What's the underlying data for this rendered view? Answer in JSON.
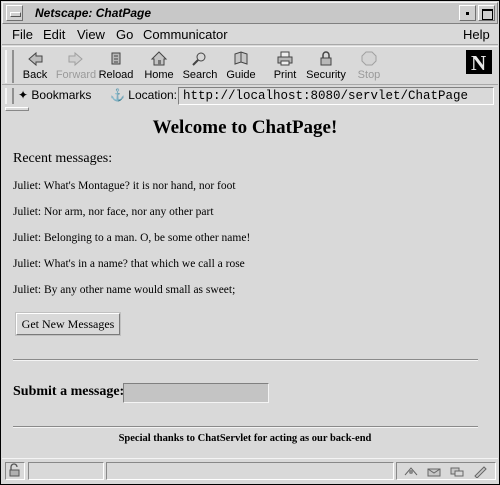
{
  "window": {
    "title": "Netscape: ChatPage"
  },
  "menubar": {
    "items": [
      "File",
      "Edit",
      "View",
      "Go",
      "Communicator"
    ],
    "help": "Help"
  },
  "toolbar": {
    "buttons": [
      {
        "label": "Back",
        "icon": "back-arrow-icon",
        "enabled": true
      },
      {
        "label": "Forward",
        "icon": "forward-arrow-icon",
        "enabled": false
      },
      {
        "label": "Reload",
        "icon": "reload-icon",
        "enabled": true
      },
      {
        "label": "Home",
        "icon": "home-icon",
        "enabled": true
      },
      {
        "label": "Search",
        "icon": "search-icon",
        "enabled": true
      },
      {
        "label": "Guide",
        "icon": "guide-icon",
        "enabled": true
      },
      {
        "label": "Print",
        "icon": "print-icon",
        "enabled": true
      },
      {
        "label": "Security",
        "icon": "lock-icon",
        "enabled": true
      },
      {
        "label": "Stop",
        "icon": "stop-icon",
        "enabled": false
      }
    ],
    "logo_letter": "N"
  },
  "locationbar": {
    "bookmarks_label": "Bookmarks",
    "location_label": "Location:",
    "url": "http://localhost:8080/servlet/ChatPage"
  },
  "page": {
    "title": "Welcome to ChatPage!",
    "recent_heading": "Recent messages:",
    "messages": [
      "Juliet: What's Montague? it is nor hand, nor foot",
      "Juliet: Nor arm, nor face, nor any other part",
      "Juliet: Belonging to a man. O, be some other name!",
      "Juliet: What's in a name? that which we call a rose",
      "Juliet: By any other name would small as sweet;"
    ],
    "get_button": "Get New Messages",
    "submit_label": "Submit a message:",
    "submit_value": "",
    "thanks": "Special thanks to ChatServlet for acting as our back-end"
  },
  "colors": {
    "chrome": "#d9d9d9",
    "input_bg": "#c4c4c4",
    "disabled_text": "#9a9a9a"
  }
}
